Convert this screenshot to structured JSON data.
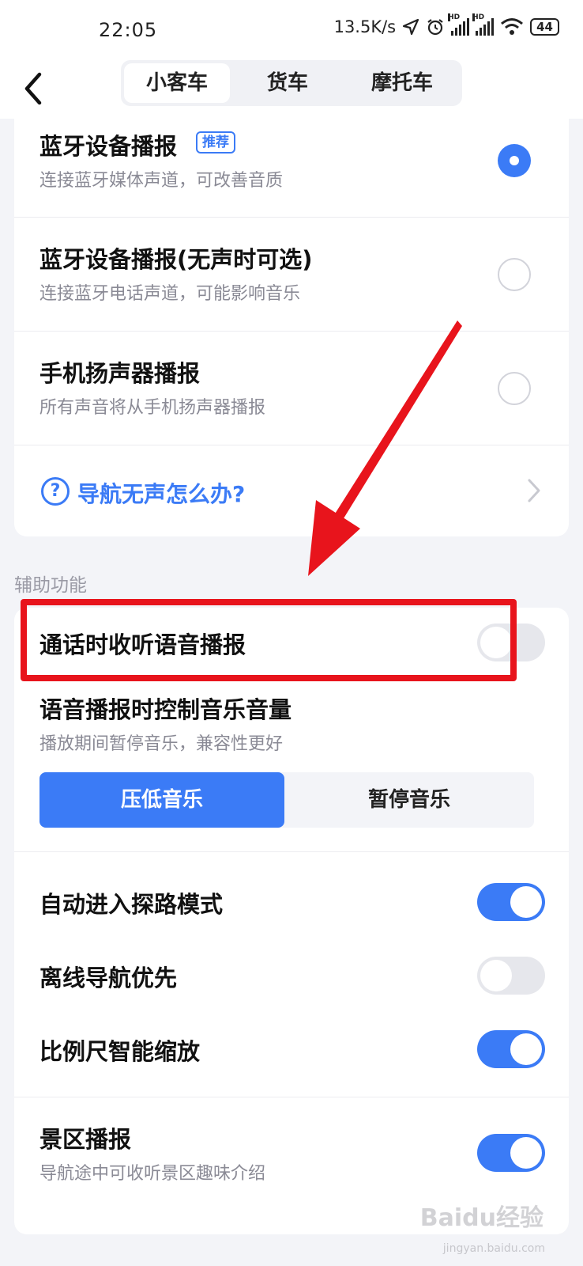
{
  "status_bar": {
    "time": "22:05",
    "net_speed": "13.5K/s",
    "battery": "44",
    "icons": [
      "location-arrow-icon",
      "alarm-icon",
      "signal-hd-icon",
      "signal-hd-icon",
      "wifi-icon",
      "battery-icon"
    ]
  },
  "header": {
    "tabs": [
      {
        "label": "小客车",
        "active": true
      },
      {
        "label": "货车",
        "active": false
      },
      {
        "label": "摩托车",
        "active": false
      }
    ]
  },
  "broadcast_options": [
    {
      "title": "蓝牙设备播报",
      "badge": "推荐",
      "subtitle": "连接蓝牙媒体声道，可改善音质",
      "selected": true
    },
    {
      "title": "蓝牙设备播报(无声时可选)",
      "subtitle": "连接蓝牙电话声道，可能影响音乐",
      "selected": false
    },
    {
      "title": "手机扬声器播报",
      "subtitle": "所有声音将从手机扬声器播报",
      "selected": false
    }
  ],
  "help_link": {
    "label": "导航无声怎么办?"
  },
  "section_title": "辅助功能",
  "call_broadcast": {
    "title": "通话时收听语音播报",
    "enabled": false
  },
  "music_control": {
    "title": "语音播报时控制音乐音量",
    "subtitle": "播放期间暂停音乐，兼容性更好",
    "options": [
      "压低音乐",
      "暂停音乐"
    ],
    "selected": "压低音乐"
  },
  "toggles": [
    {
      "title": "自动进入探路模式",
      "enabled": true
    },
    {
      "title": "离线导航优先",
      "enabled": false
    },
    {
      "title": "比例尺智能缩放",
      "enabled": true
    }
  ],
  "scenic": {
    "title": "景区播报",
    "subtitle": "导航途中可收听景区趣味介绍",
    "enabled": true
  },
  "watermark": {
    "logo": "Baidu经验",
    "url": "jingyan.baidu.com"
  },
  "colors": {
    "accent": "#3b7bf6",
    "annotation_red": "#e8141c"
  }
}
